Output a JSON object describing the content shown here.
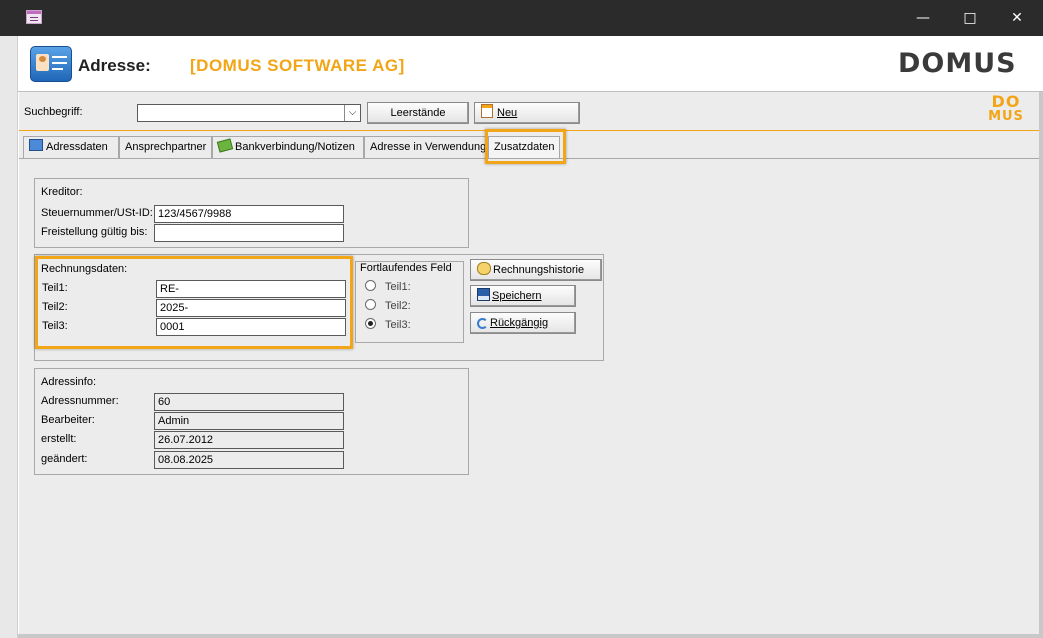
{
  "header": {
    "title": "Adresse:",
    "company": "[DOMUS SOFTWARE AG]",
    "logo_text": "DOMUS",
    "logo_small_top": "DO",
    "logo_small_bottom": "MUS",
    "accent_color": "#f2a516"
  },
  "search": {
    "label": "Suchbegriff:",
    "value": "",
    "leerstaende_label": "Leerstände",
    "neu_label": "Neu"
  },
  "tabs": [
    {
      "label": "Adressdaten"
    },
    {
      "label": "Ansprechpartner"
    },
    {
      "label": "Bankverbindung/Notizen"
    },
    {
      "label": "Adresse in Verwendung"
    },
    {
      "label": "Zusatzdaten",
      "active": true
    }
  ],
  "kreditor": {
    "title": "Kreditor:",
    "steuer_label": "Steuernummer/USt-ID:",
    "steuer_value": "123/4567/9988",
    "freistellung_label": "Freistellung gültig bis:",
    "freistellung_value": ""
  },
  "rechnung": {
    "title": "Rechnungsdaten:",
    "teil1_label": "Teil1:",
    "teil1_value": "RE-",
    "teil2_label": "Teil2:",
    "teil2_value": "2025-",
    "teil3_label": "Teil3:",
    "teil3_value": "0001"
  },
  "fortlaufend": {
    "title": "Fortlaufendes Feld",
    "options": [
      "Teil1:",
      "Teil2:",
      "Teil3:"
    ],
    "selected": "Teil3:"
  },
  "buttons": {
    "historie": "Rechnungshistorie",
    "speichern": "Speichern",
    "rueckgaengig": "Rückgängig"
  },
  "adressinfo": {
    "title": "Adressinfo:",
    "nummer_label": "Adressnummer:",
    "nummer_value": "60",
    "bearbeiter_label": "Bearbeiter:",
    "bearbeiter_value": "Admin",
    "erstellt_label": "erstellt:",
    "erstellt_value": "26.07.2012",
    "geaendert_label": "geändert:",
    "geaendert_value": "08.08.2025"
  }
}
